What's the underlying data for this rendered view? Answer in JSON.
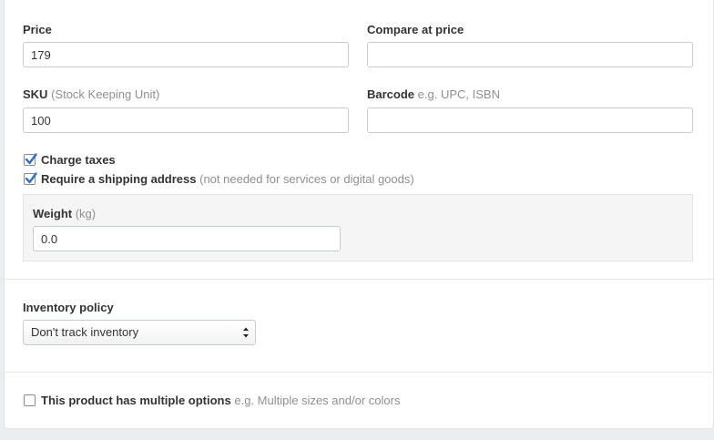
{
  "pricing": {
    "price_label": "Price",
    "price_value": "179",
    "compare_label": "Compare at price",
    "compare_value": ""
  },
  "inventory_ids": {
    "sku_label": "SKU",
    "sku_hint": "(Stock Keeping Unit)",
    "sku_value": "100",
    "barcode_label": "Barcode",
    "barcode_hint": "e.g. UPC, ISBN",
    "barcode_value": ""
  },
  "options": {
    "charge_taxes_label": "Charge taxes",
    "charge_taxes_checked": true,
    "shipping_label": "Require a shipping address",
    "shipping_hint": "(not needed for services or digital goods)",
    "shipping_checked": true
  },
  "weight": {
    "label": "Weight",
    "unit_hint": "(kg)",
    "value": "0.0"
  },
  "inventory_policy": {
    "label": "Inventory policy",
    "selected": "Don't track inventory"
  },
  "variants": {
    "label": "This product has multiple options",
    "hint": "e.g. Multiple sizes and/or colors",
    "checked": false
  },
  "colors": {
    "checkbox_accent": "#2c6ecb"
  }
}
